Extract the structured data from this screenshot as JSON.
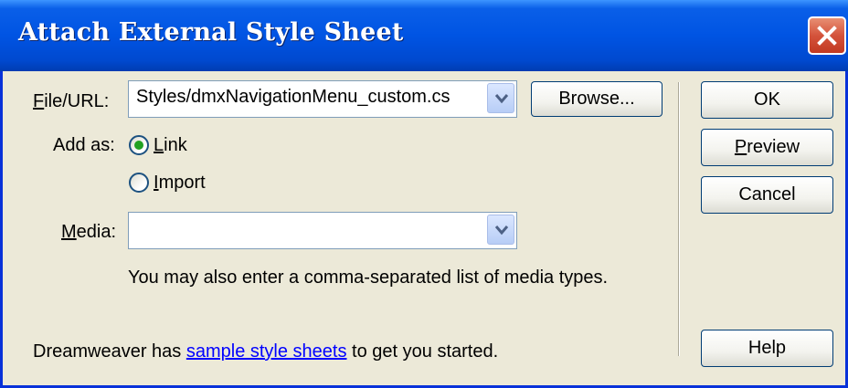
{
  "window": {
    "title": "Attach External Style Sheet"
  },
  "file_url": {
    "label_pre": "",
    "label_mnemonic": "F",
    "label_post": "ile/URL:",
    "value": "Styles/dmxNavigationMenu_custom.cs"
  },
  "browse_button": "Browse...",
  "add_as": {
    "label": "Add as:",
    "options": [
      {
        "mnemonic": "L",
        "rest": "ink",
        "selected": true
      },
      {
        "mnemonic": "I",
        "rest": "mport",
        "selected": false
      }
    ]
  },
  "media": {
    "label_mnemonic": "M",
    "label_post": "edia:",
    "value": "",
    "hint": "You may also enter a comma-separated list of media types."
  },
  "footer": {
    "pre": "Dreamweaver has ",
    "link": "sample style sheets",
    "post": " to get you started."
  },
  "buttons": {
    "ok": "OK",
    "preview_mnemonic": "P",
    "preview_rest": "review",
    "cancel": "Cancel",
    "help": "Help"
  },
  "colors": {
    "titlebar": "#0054e3",
    "dialog_bg": "#ece9d8",
    "close_button": "#d4533b",
    "radio_selected": "#21a121",
    "link": "#0000ff"
  }
}
